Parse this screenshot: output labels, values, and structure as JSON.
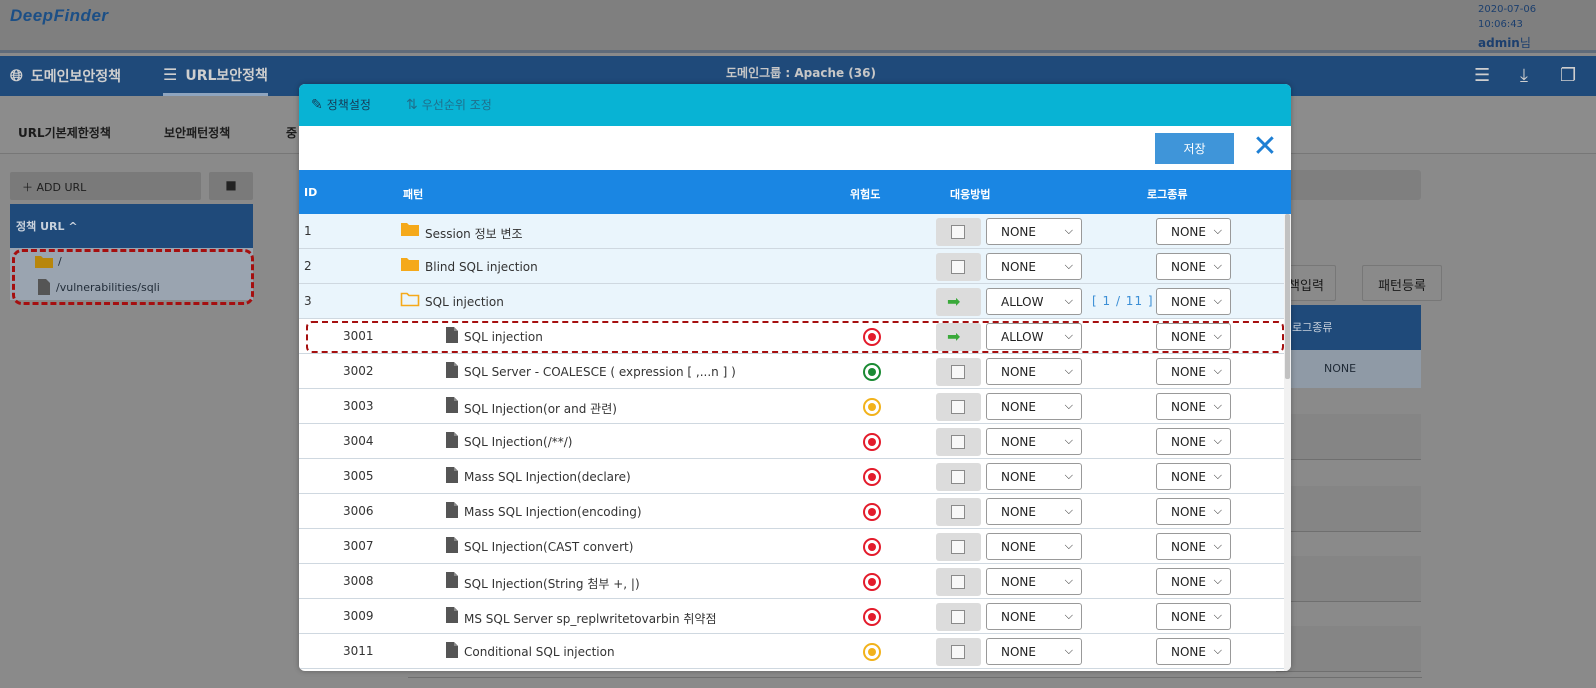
{
  "app": {
    "logo": "DeepFinder",
    "date": "2020-07-06",
    "time": "10:06:43",
    "user": "admin",
    "user_suffix": "님"
  },
  "nav": {
    "domain_policy": "도메인보안정책",
    "url_policy": "URL보안정책",
    "domain_group": "도메인그룹 : Apache (36)"
  },
  "subtabs": [
    "URL기본제한정책",
    "보안패턴정책",
    "중"
  ],
  "left": {
    "add_url": "ADD URL",
    "policy_url_header": "정책 URL",
    "tree": [
      "/",
      "/vulnerabilities/sqli"
    ]
  },
  "right": {
    "btn1": "책입력",
    "btn2": "패턴등록",
    "header": "로그종류",
    "cell": "NONE"
  },
  "modal": {
    "tab_settings": "정책설정",
    "tab_priority": "우선순위 조정",
    "save": "저장",
    "columns": {
      "id": "ID",
      "pattern": "패턴",
      "risk": "위험도",
      "action": "대응방법",
      "log": "로그종류"
    },
    "rows": [
      {
        "id": "1",
        "pattern": "Session 정보 변조",
        "type": "folder",
        "risk": "",
        "action": "NONE",
        "log": "NONE"
      },
      {
        "id": "2",
        "pattern": "Blind SQL injection",
        "type": "folder",
        "risk": "",
        "action": "NONE",
        "log": "NONE"
      },
      {
        "id": "3",
        "pattern": "SQL injection",
        "type": "folder-open",
        "risk": "",
        "action": "ALLOW",
        "log": "NONE",
        "pager": "[ 1 / 11 ]"
      },
      {
        "id": "3001",
        "pattern": "SQL injection",
        "type": "file",
        "risk": "high",
        "action": "ALLOW",
        "log": "NONE"
      },
      {
        "id": "3002",
        "pattern": "SQL Server - COALESCE ( expression [ ,...n ] )",
        "type": "file",
        "risk": "low",
        "action": "NONE",
        "log": "NONE"
      },
      {
        "id": "3003",
        "pattern": "SQL Injection(or and 관련)",
        "type": "file",
        "risk": "mid",
        "action": "NONE",
        "log": "NONE"
      },
      {
        "id": "3004",
        "pattern": "SQL Injection(/**/)",
        "type": "file",
        "risk": "high",
        "action": "NONE",
        "log": "NONE"
      },
      {
        "id": "3005",
        "pattern": "Mass SQL Injection(declare)",
        "type": "file",
        "risk": "high",
        "action": "NONE",
        "log": "NONE"
      },
      {
        "id": "3006",
        "pattern": "Mass SQL Injection(encoding)",
        "type": "file",
        "risk": "high",
        "action": "NONE",
        "log": "NONE"
      },
      {
        "id": "3007",
        "pattern": "SQL Injection(CAST convert)",
        "type": "file",
        "risk": "high",
        "action": "NONE",
        "log": "NONE"
      },
      {
        "id": "3008",
        "pattern": "SQL Injection(String 첨부 +, |)",
        "type": "file",
        "risk": "high",
        "action": "NONE",
        "log": "NONE"
      },
      {
        "id": "3009",
        "pattern": "MS SQL Server sp_replwritetovarbin 취약점",
        "type": "file",
        "risk": "high",
        "action": "NONE",
        "log": "NONE"
      },
      {
        "id": "3011",
        "pattern": "Conditional SQL injection",
        "type": "file",
        "risk": "mid",
        "action": "NONE",
        "log": "NONE"
      }
    ]
  },
  "colors": {
    "modal_header": "#08b3d4",
    "table_header": "#1a86e3",
    "save_button": "#3f95d9",
    "risk_high": "#e31b2b",
    "risk_low": "#1a8a33",
    "risk_mid": "#f2b21b",
    "highlight_border": "#a50f0f"
  }
}
